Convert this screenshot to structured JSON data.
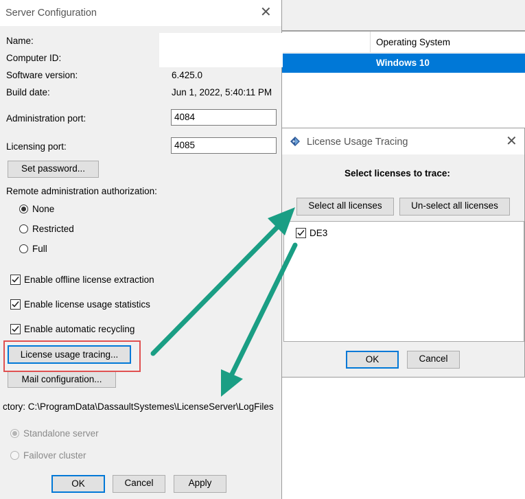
{
  "background_window": {
    "column_header": "Operating System",
    "selected_row_os": "Windows 10"
  },
  "server_config": {
    "title": "Server Configuration",
    "fields": {
      "name_label": "Name:",
      "computer_id_label": "Computer ID:",
      "software_version_label": "Software version:",
      "software_version_value": "6.425.0",
      "build_date_label": "Build date:",
      "build_date_value": "Jun 1, 2022, 5:40:11 PM",
      "admin_port_label": "Administration port:",
      "admin_port_value": "4084",
      "licensing_port_label": "Licensing port:",
      "licensing_port_value": "4085"
    },
    "set_password_button": "Set password...",
    "remote_auth_label": "Remote administration authorization:",
    "remote_auth_options": [
      "None",
      "Restricted",
      "Full"
    ],
    "remote_auth_selected": "None",
    "checkboxes": [
      {
        "label": "Enable offline license extraction",
        "checked": true
      },
      {
        "label": "Enable license usage statistics",
        "checked": true
      },
      {
        "label": "Enable automatic recycling",
        "checked": true
      }
    ],
    "license_usage_tracing_button": "License usage tracing...",
    "mail_configuration_button": "Mail configuration...",
    "directory_text": "ctory: C:\\ProgramData\\DassaultSystemes\\LicenseServer\\LogFiles",
    "server_mode_options": [
      "Standalone server",
      "Failover cluster"
    ],
    "server_mode_selected": "Standalone server",
    "ok_button": "OK",
    "cancel_button": "Cancel",
    "apply_button": "Apply"
  },
  "license_tracing": {
    "title": "License Usage Tracing",
    "heading": "Select licenses to trace:",
    "select_all_button": "Select all licenses",
    "unselect_all_button": "Un-select all licenses",
    "licenses": [
      {
        "name": "DE3",
        "checked": true
      }
    ],
    "ok_button": "OK",
    "cancel_button": "Cancel"
  },
  "annotations": {
    "highlight_color": "#e05050",
    "arrow_color": "#1a9e84"
  }
}
